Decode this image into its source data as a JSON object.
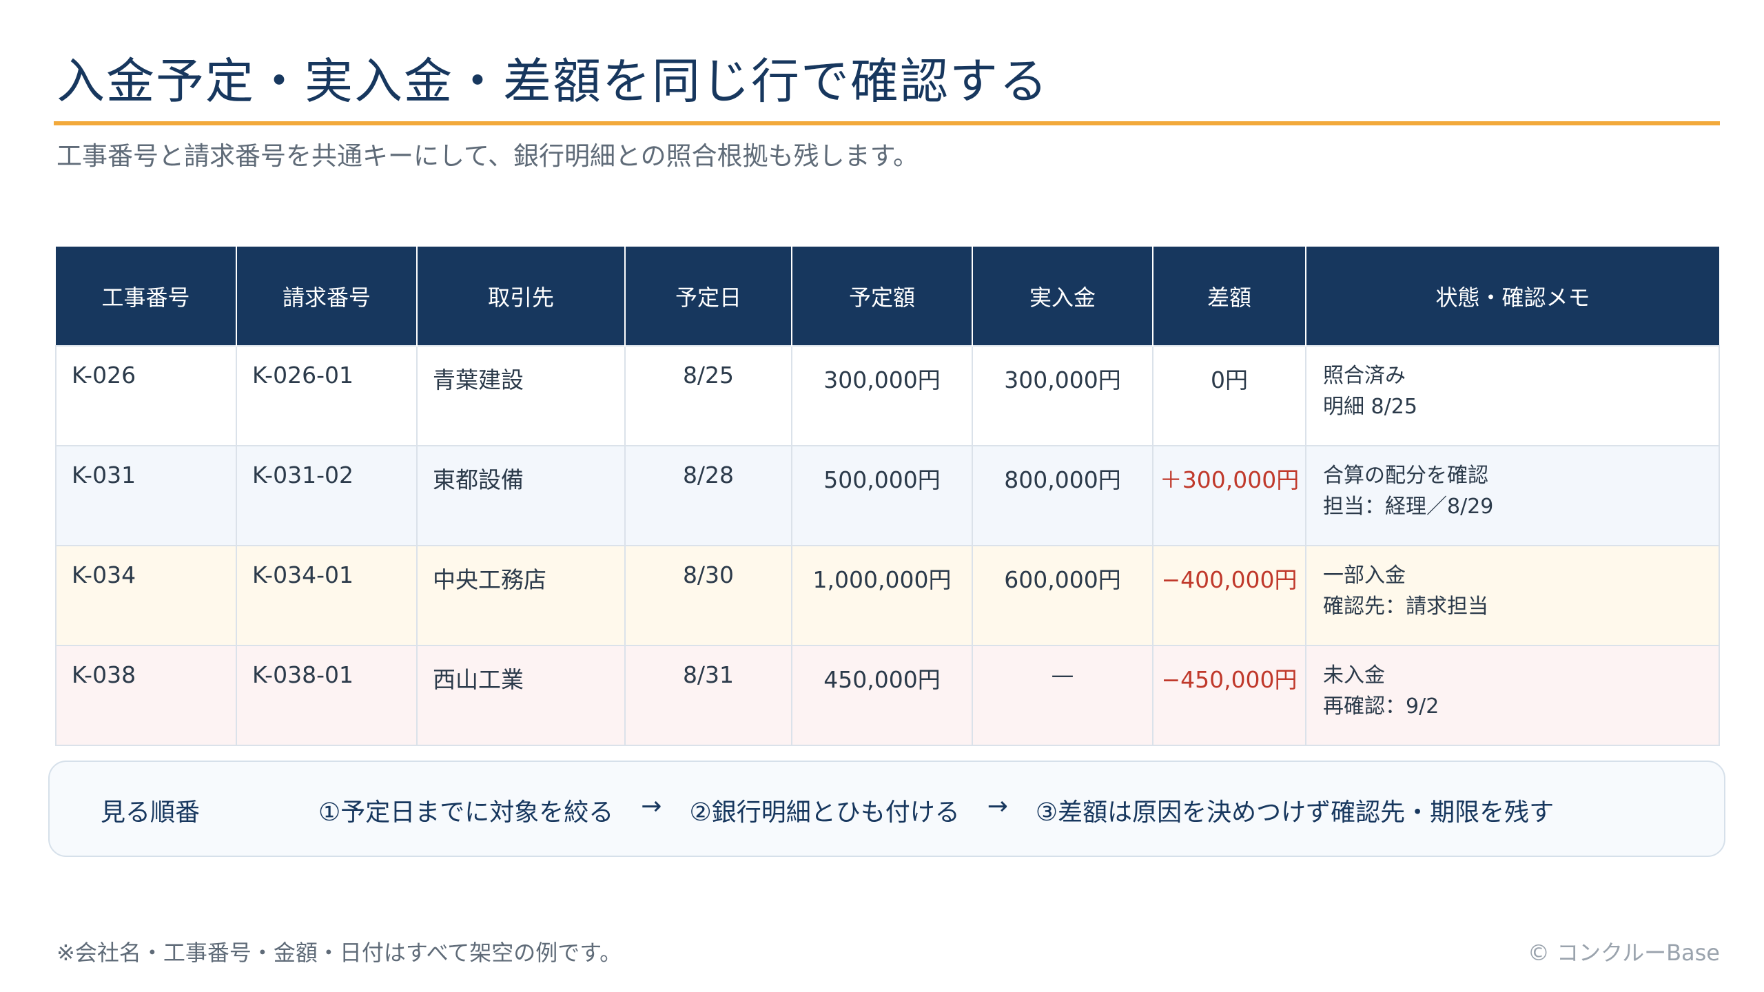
{
  "title": "入金予定・実入金・差額を同じ行で確認する",
  "subtitle": "工事番号と請求番号を共通キーにして、銀行明細との照合根拠も残します。",
  "accent_color": "#f2a93b",
  "header_color": "#17375e",
  "table": {
    "headers": [
      "工事番号",
      "請求番号",
      "取引先",
      "予定日",
      "予定額",
      "実入金",
      "差額",
      "状態・確認メモ"
    ],
    "rows": [
      {
        "job": "K-026",
        "invoice": "K-026-01",
        "client": "青葉建設",
        "due": "8/25",
        "planned": "300,000円",
        "actual": "300,000円",
        "diff": "0円",
        "memo1": "照合済み",
        "memo2": "明細 8/25"
      },
      {
        "job": "K-031",
        "invoice": "K-031-02",
        "client": "東都設備",
        "due": "8/28",
        "planned": "500,000円",
        "actual": "800,000円",
        "diff": "＋300,000円",
        "memo1": "合算の配分を確認",
        "memo2": "担当：経理／8/29"
      },
      {
        "job": "K-034",
        "invoice": "K-034-01",
        "client": "中央工務店",
        "due": "8/30",
        "planned": "1,000,000円",
        "actual": "600,000円",
        "diff": "−400,000円",
        "memo1": "一部入金",
        "memo2": "確認先：請求担当"
      },
      {
        "job": "K-038",
        "invoice": "K-038-01",
        "client": "西山工業",
        "due": "8/31",
        "planned": "450,000円",
        "actual": "—",
        "diff": "−450,000円",
        "memo1": "未入金",
        "memo2": "再確認：9/2"
      }
    ]
  },
  "flow": {
    "label": "見る順番",
    "steps": [
      "①予定日までに対象を絞る",
      "②銀行明細とひも付ける",
      "③差額は原因を決めつけず確認先・期限を残す"
    ],
    "arrow": "→"
  },
  "footnote": "※会社名・工事番号・金額・日付はすべて架空の例です。",
  "copyright": "© コンクルーBase"
}
